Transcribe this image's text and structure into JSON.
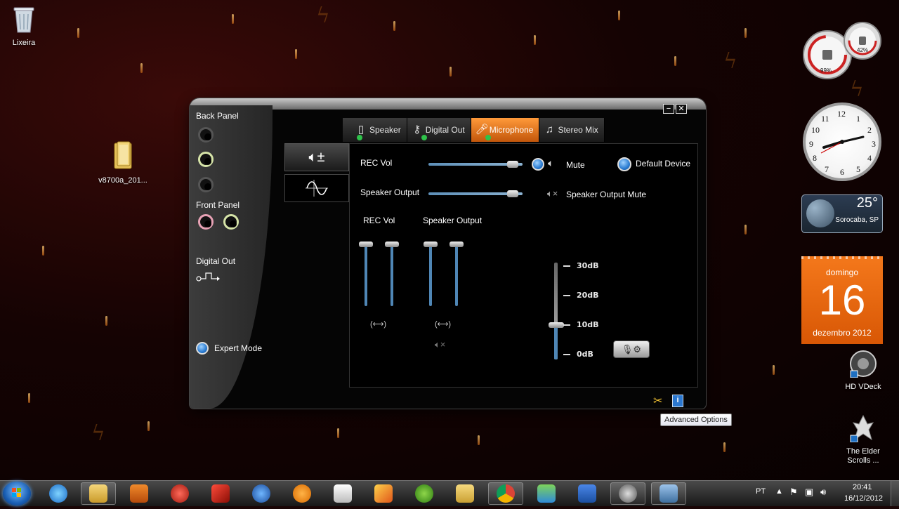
{
  "desktop": {
    "icons": [
      {
        "label": "Lixeira"
      },
      {
        "label": "v8700a_201..."
      }
    ],
    "right_icons": [
      {
        "label": "HD VDeck"
      },
      {
        "label_line1": "The Elder",
        "label_line2": "Scrolls ..."
      }
    ]
  },
  "gadgets": {
    "cpu_meter": {
      "left_value": "99%",
      "right_value": "42%"
    },
    "weather": {
      "temp": "25°",
      "city": "Sorocaba, SP"
    },
    "calendar": {
      "weekday": "domingo",
      "day": "16",
      "month_year": "dezembro 2012"
    },
    "clock": {
      "numbers": [
        "12",
        "1",
        "2",
        "3",
        "4",
        "5",
        "6",
        "7",
        "8",
        "9",
        "10",
        "11"
      ]
    }
  },
  "audio_window": {
    "side": {
      "back_panel": "Back Panel",
      "front_panel": "Front Panel",
      "digital_out": "Digital Out",
      "expert_mode": "Expert Mode"
    },
    "tabs": [
      {
        "label": "Speaker",
        "icon": "speaker-icon",
        "active": false
      },
      {
        "label": "Digital Out",
        "icon": "digital-out-icon",
        "active": false
      },
      {
        "label": "Microphone",
        "icon": "microphone-icon",
        "active": true
      },
      {
        "label": "Stereo Mix",
        "icon": "music-note-icon",
        "active": false
      }
    ],
    "panel": {
      "rec_vol_label": "REC Vol",
      "speaker_output_label": "Speaker Output",
      "mute_label": "Mute",
      "default_device_label": "Default Device",
      "speaker_output_mute_label": "Speaker Output Mute",
      "rec_vol_column": "REC Vol",
      "speaker_output_column": "Speaker Output",
      "rec_vol_level": 0.95,
      "speaker_output_level": 0.95,
      "boost_levels": [
        "30dB",
        "20dB",
        "10dB",
        "0dB"
      ],
      "boost_selected": "10dB"
    },
    "tooltip": "Advanced Options"
  },
  "taskbar": {
    "language": "PT",
    "time": "20:41",
    "date": "16/12/2012"
  },
  "colors": {
    "accent_orange": "#f0821e",
    "slider_blue": "#4f86b5",
    "calendar_orange": "#e96511"
  }
}
